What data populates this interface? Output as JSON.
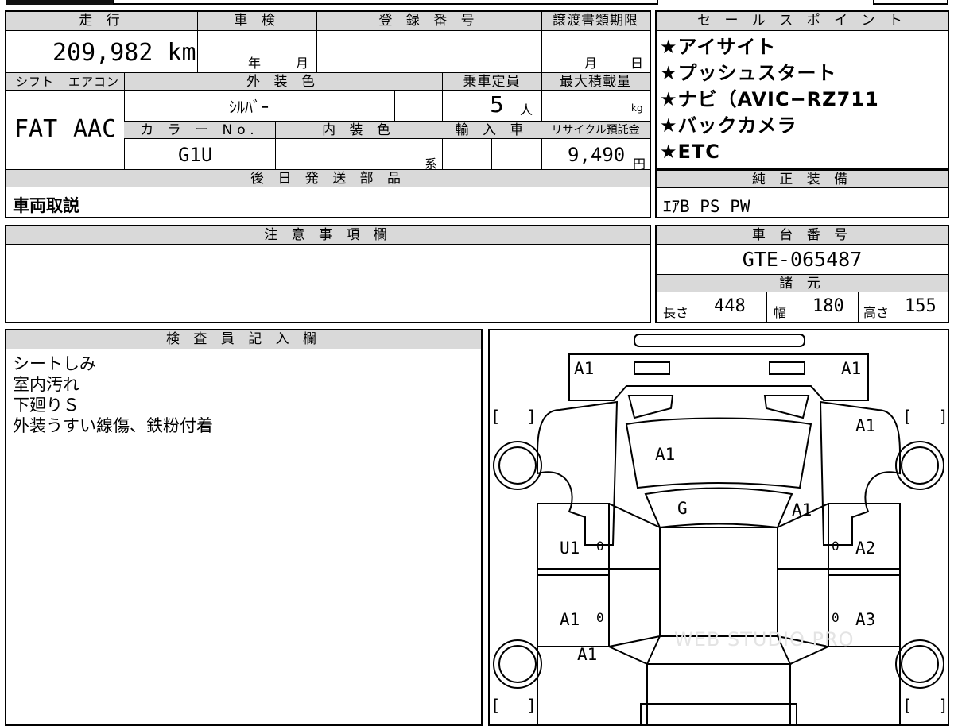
{
  "top": {
    "mileage_label": "走 行",
    "mileage_value": "209,982 km",
    "inspection_label": "車 検",
    "inspection_year_unit": "年",
    "inspection_month_unit": "月",
    "registration_label": "登 録 番 号",
    "transfer_label": "譲渡書類期限",
    "transfer_month_unit": "月",
    "transfer_day_unit": "日",
    "shift_label": "シフト",
    "shift_value": "FAT",
    "aircon_label": "エアコン",
    "aircon_value": "AAC",
    "exterior_color_label": "外 装 色",
    "exterior_color_value": "ｼﾙﾊﾞｰ",
    "capacity_label": "乗車定員",
    "capacity_value": "5",
    "capacity_unit": "人",
    "max_load_label": "最大積載量",
    "max_load_unit": "kg",
    "color_no_label": "カ ラ ー No.",
    "color_no_value": "G1U",
    "interior_color_label": "内 装 色",
    "interior_color_suffix": "系",
    "import_label": "輸 入 車",
    "recycle_label": "リサイクル預託金",
    "recycle_value": "9,490",
    "recycle_unit": "円",
    "later_parts_label": "後 日 発 送 部 品",
    "later_parts_value": "車両取説"
  },
  "sales_points": {
    "label": "セ ー ル ス ポ イ ン ト",
    "items": [
      "★アイサイト",
      "★プッシュスタート",
      "★ナビ（AVIC−RZ711",
      "★バックカメラ",
      "★ETC"
    ]
  },
  "equipment": {
    "label": "純 正 装 備",
    "value": "ｴｱB PS PW"
  },
  "notes": {
    "label": "注 意 事 項 欄"
  },
  "chassis": {
    "label": "車 台 番 号",
    "value": "GTE-065487"
  },
  "specs": {
    "label": "諸 元",
    "length_label": "長さ",
    "length_value": "448",
    "width_label": "幅",
    "width_value": "180",
    "height_label": "高さ",
    "height_value": "155"
  },
  "inspector": {
    "label": "検 査 員 記 入 欄",
    "lines": [
      "シートしみ",
      "室内汚れ",
      "下廻りＳ",
      "外装うすい線傷、鉄粉付着"
    ]
  },
  "diagram": {
    "marks": {
      "front_left": "A1",
      "front_right": "A1",
      "right_front_fender": "A1",
      "hood": "A1",
      "windshield": "G",
      "right_a_pillar": "A1",
      "left_front_door": "U1",
      "right_front_door": "A2",
      "left_rear_door": "A1",
      "right_rear_door": "A3",
      "left_rear_quarter": "A1"
    },
    "zero_marks": [
      "0",
      "0",
      "0",
      "0"
    ],
    "bracket_left": "[",
    "bracket_right": "]",
    "watermark": "WEB STUDIO PRO"
  }
}
